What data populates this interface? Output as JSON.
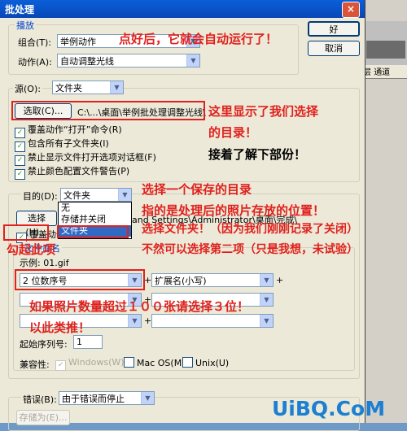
{
  "window": {
    "title": "批处理",
    "close_glyph": "×"
  },
  "background_app": {
    "tab_label": "层",
    "tab2_label": "通道"
  },
  "play_group": {
    "title": "播放",
    "set_label": "组合(T):",
    "set_value": "举例动作",
    "action_label": "动作(A):",
    "action_value": "自动调整光线"
  },
  "buttons": {
    "ok": "好",
    "cancel": "取消"
  },
  "source": {
    "label": "源(O):",
    "value": "文件夹",
    "choose_button": "选取(C)...",
    "path": "C:\\...\\桌面\\举例批处理调整光线\\",
    "options": [
      {
        "label": "覆盖动作“打开”命令(R)",
        "checked": true
      },
      {
        "label": "包含所有子文件夹(I)",
        "checked": true
      },
      {
        "label": "禁止显示文件打开选项对话框(F)",
        "checked": true
      },
      {
        "label": "禁止颜色配置文件警告(P)",
        "checked": true
      }
    ]
  },
  "destination": {
    "label": "目的(D):",
    "value": "文件夹",
    "dropdown_options": [
      "无",
      "存储并关闭",
      "文件夹"
    ],
    "choose_button": "选择(H)...",
    "path": "and Settings\\Administrator\\桌面\\完成\\",
    "override_label": "覆盖动作",
    "naming_title": "文件命名",
    "example": "示例: 01.gif",
    "naming": [
      "2 位数序号",
      "扩展名(小写)",
      "",
      "",
      "",
      ""
    ],
    "start_serial_label": "起始序列号:",
    "start_serial": "1",
    "compat_label": "兼容性:",
    "compat": [
      {
        "label": "Windows(W)",
        "checked": true,
        "disabled": true
      },
      {
        "label": "Mac OS(M)",
        "checked": false,
        "disabled": false
      },
      {
        "label": "Unix(U)",
        "checked": false,
        "disabled": false
      }
    ]
  },
  "errors": {
    "label": "错误(B):",
    "value": "由于错误而停止",
    "save_as_button": "存储为(E)..."
  },
  "annotations": {
    "a1": "点好后，它就会自动运行了！",
    "a2": "这里显示了我们选择",
    "a3": "的目录！",
    "a4": "接着了解下部份！",
    "a5": "选择一个保存的目录",
    "a6": "指的是处理后的照片存放的位置！",
    "a7": "选择文件夹！（因为我们刚刚记录了关闭）",
    "a8": "不然可以选择第二项（只是我想，未试验）",
    "a9": "勾起此项",
    "a10": "如果照片数量超过１００张请选择３位！",
    "a11": "以此类推！"
  },
  "watermark": "UiBQ.CoM",
  "colors": {
    "annotation": "#e0211d",
    "title_bar": "#0a5fd8",
    "dialog_bg": "#ece9d8",
    "watermark": "#1c7fd1"
  }
}
